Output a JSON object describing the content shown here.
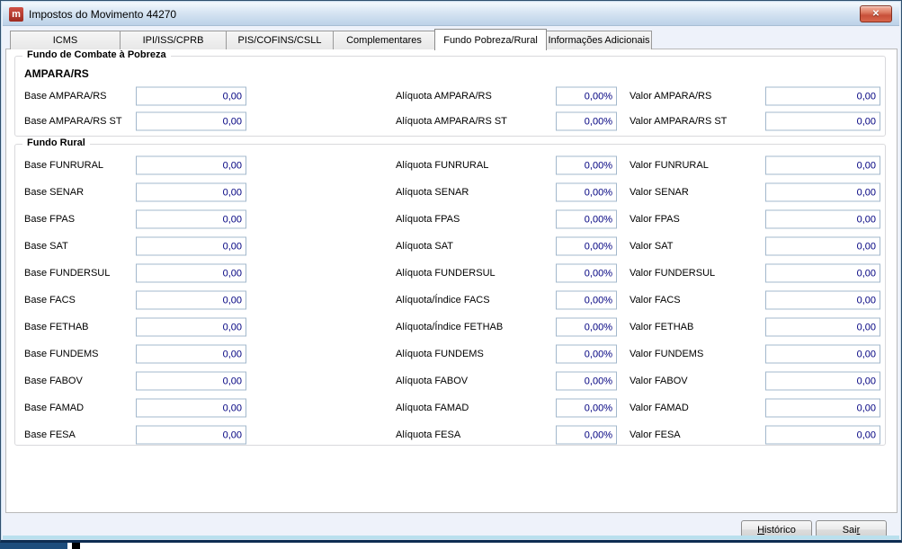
{
  "window": {
    "title": "Impostos do Movimento 44270",
    "icon_glyph": "m",
    "close_glyph": "✕"
  },
  "tabs": {
    "active": "Fundo Pobreza/Rural",
    "items": [
      {
        "label": "ICMS"
      },
      {
        "label": "IPI/ISS/CPRB"
      },
      {
        "label": "PIS/COFINS/CSLL"
      },
      {
        "label": "Complementares"
      },
      {
        "label": "Fundo Pobreza/Rural"
      },
      {
        "label": "Informações Adicionais"
      }
    ]
  },
  "poverty_group": {
    "title": "Fundo de Combate à Pobreza",
    "subtitle": "AMPARA/RS",
    "rows": [
      {
        "base_label": "Base AMPARA/RS",
        "base_value": "0,00",
        "aliq_label": "Alíquota AMPARA/RS",
        "aliq_value": "0,00%",
        "valor_label": "Valor AMPARA/RS",
        "valor_value": "0,00"
      },
      {
        "base_label": "Base AMPARA/RS ST",
        "base_value": "0,00",
        "aliq_label": "Alíquota AMPARA/RS ST",
        "aliq_value": "0,00%",
        "valor_label": "Valor AMPARA/RS ST",
        "valor_value": "0,00"
      }
    ]
  },
  "rural_group": {
    "title": "Fundo Rural",
    "rows": [
      {
        "base_label": "Base FUNRURAL",
        "base_value": "0,00",
        "aliq_label": "Alíquota FUNRURAL",
        "aliq_value": "0,00%",
        "valor_label": "Valor FUNRURAL",
        "valor_value": "0,00"
      },
      {
        "base_label": "Base SENAR",
        "base_value": "0,00",
        "aliq_label": "Alíquota SENAR",
        "aliq_value": "0,00%",
        "valor_label": "Valor SENAR",
        "valor_value": "0,00"
      },
      {
        "base_label": "Base FPAS",
        "base_value": "0,00",
        "aliq_label": "Alíquota FPAS",
        "aliq_value": "0,00%",
        "valor_label": "Valor FPAS",
        "valor_value": "0,00"
      },
      {
        "base_label": "Base SAT",
        "base_value": "0,00",
        "aliq_label": "Alíquota SAT",
        "aliq_value": "0,00%",
        "valor_label": "Valor SAT",
        "valor_value": "0,00"
      },
      {
        "base_label": "Base FUNDERSUL",
        "base_value": "0,00",
        "aliq_label": "Alíquota FUNDERSUL",
        "aliq_value": "0,00%",
        "valor_label": "Valor FUNDERSUL",
        "valor_value": "0,00"
      },
      {
        "base_label": "Base FACS",
        "base_value": "0,00",
        "aliq_label": "Alíquota/Índice FACS",
        "aliq_value": "0,00%",
        "valor_label": "Valor FACS",
        "valor_value": "0,00"
      },
      {
        "base_label": "Base FETHAB",
        "base_value": "0,00",
        "aliq_label": "Alíquota/Índice FETHAB",
        "aliq_value": "0,00%",
        "valor_label": "Valor FETHAB",
        "valor_value": "0,00"
      },
      {
        "base_label": "Base FUNDEMS",
        "base_value": "0,00",
        "aliq_label": "Alíquota FUNDEMS",
        "aliq_value": "0,00%",
        "valor_label": "Valor FUNDEMS",
        "valor_value": "0,00"
      },
      {
        "base_label": "Base FABOV",
        "base_value": "0,00",
        "aliq_label": "Alíquota FABOV",
        "aliq_value": "0,00%",
        "valor_label": "Valor FABOV",
        "valor_value": "0,00"
      },
      {
        "base_label": "Base FAMAD",
        "base_value": "0,00",
        "aliq_label": "Alíquota FAMAD",
        "aliq_value": "0,00%",
        "valor_label": "Valor FAMAD",
        "valor_value": "0,00"
      },
      {
        "base_label": "Base FESA",
        "base_value": "0,00",
        "aliq_label": "Alíquota FESA",
        "aliq_value": "0,00%",
        "valor_label": "Valor FESA",
        "valor_value": "0,00"
      }
    ]
  },
  "footer": {
    "historico": {
      "pre": "",
      "key": "H",
      "post": "istórico"
    },
    "sair": {
      "pre": "Sai",
      "key": "r",
      "post": ""
    }
  },
  "colors": {
    "value_text": "#000080",
    "titlebar_accent": "#bcd2e8",
    "close_red": "#c8503a",
    "field_border": "#a3b8cc"
  }
}
